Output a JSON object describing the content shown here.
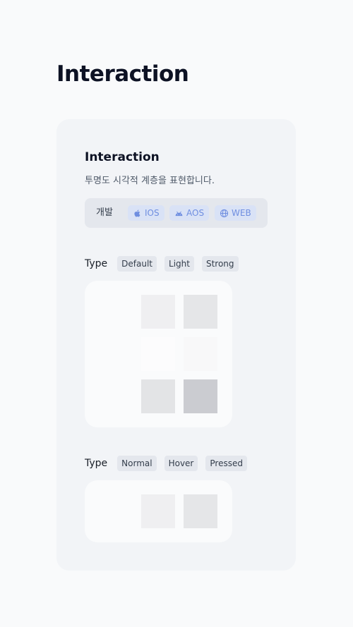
{
  "page": {
    "title": "Interaction"
  },
  "card": {
    "title": "Interaction",
    "description": "투명도 시각적 계층을 표현합니다.",
    "platforms": {
      "label": "개발",
      "items": [
        {
          "label": "IOS",
          "icon": "apple-icon"
        },
        {
          "label": "AOS",
          "icon": "android-icon"
        },
        {
          "label": "WEB",
          "icon": "globe-icon"
        }
      ]
    },
    "type_group_1": {
      "label": "Type",
      "options": [
        "Default",
        "Light",
        "Strong"
      ]
    },
    "type_group_2": {
      "label": "Type",
      "options": [
        "Normal",
        "Hover",
        "Pressed"
      ]
    }
  },
  "colors": {
    "page_bg": "#f9fafb",
    "card_bg": "#f2f4f7",
    "chip_bg": "#e4e7ed",
    "platform_chip_bg": "#d9e2f6",
    "platform_chip_text": "#6f8ee0",
    "preview_bg": "#fafbfc"
  }
}
